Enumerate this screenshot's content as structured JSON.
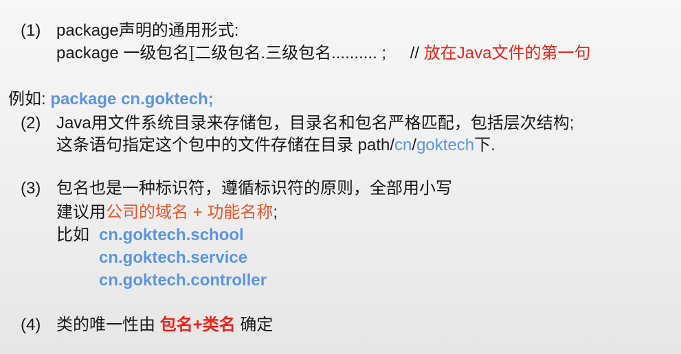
{
  "section1": {
    "num": "(1)",
    "title": "package声明的通用形式:",
    "syntax_prefix": "package 一级包名",
    "syntax_dot": ".",
    "syntax_rest": "二级包名.三级包名.......... ;",
    "comment_slashes": "//",
    "comment_text": "放在Java文件的第一句"
  },
  "example": {
    "label": "例如:",
    "code": "package cn.goktech;"
  },
  "section2": {
    "num": "(2)",
    "line1": "Java用文件系统目录来存储包，目录名和包名严格匹配，包括层次结构;",
    "line2_prefix": "这条语句指定这个包中的文件存储在目录 path/",
    "line2_cn": "cn",
    "line2_slash": "/",
    "line2_goktech": "goktech",
    "line2_suffix": "下."
  },
  "section3": {
    "num": "(3)",
    "line1": "包名也是一种标识符，遵循标识符的原则，全部用小写",
    "line2_prefix": "建议用",
    "line2_highlight": "公司的域名 + 功能名称",
    "line2_suffix": ";",
    "examples_label": "比如",
    "examples": [
      "cn.goktech.school",
      "cn.goktech.service",
      "cn.goktech.controller"
    ]
  },
  "section4": {
    "num": "(4)",
    "prefix": "类的唯一性由",
    "highlight": "包名+类名",
    "suffix": "确定"
  },
  "colors": {
    "blue": "#5b95e0",
    "red": "#e8261b",
    "orange": "#e8572e"
  }
}
